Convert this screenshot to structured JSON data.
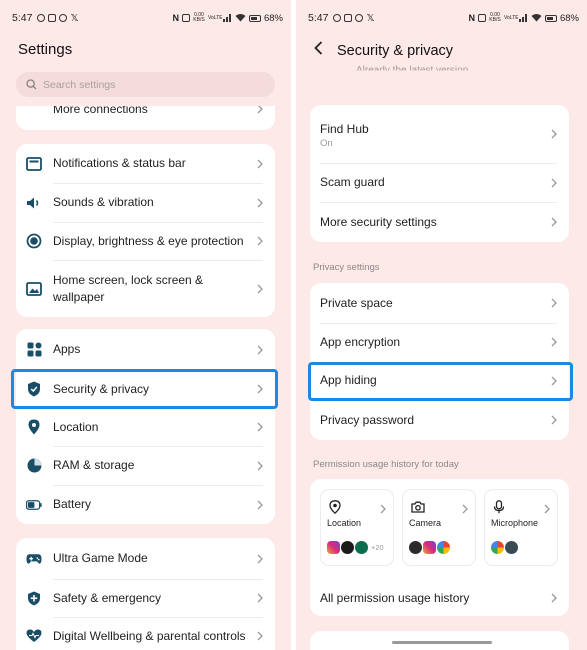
{
  "left": {
    "status": {
      "time": "5:47",
      "battery": "68%",
      "net_rate": "0.00 KB/S",
      "net_type": "VoLTE"
    },
    "title": "Settings",
    "search": {
      "placeholder": "Search settings"
    },
    "top_partial": "More connections",
    "group1": [
      {
        "label": "Notifications & status bar",
        "icon": "notification-icon"
      },
      {
        "label": "Sounds & vibration",
        "icon": "speaker-icon"
      },
      {
        "label": "Display, brightness & eye protection",
        "icon": "display-icon"
      },
      {
        "label": "Home screen, lock screen & wallpaper",
        "icon": "wallpaper-icon"
      }
    ],
    "group2": [
      {
        "label": "Apps",
        "icon": "apps-grid-icon"
      },
      {
        "label": "Security & privacy",
        "icon": "shield-icon"
      },
      {
        "label": "Location",
        "icon": "location-pin-icon"
      },
      {
        "label": "RAM & storage",
        "icon": "storage-pie-icon"
      },
      {
        "label": "Battery",
        "icon": "battery-icon"
      }
    ],
    "group3": [
      {
        "label": "Ultra Game Mode",
        "icon": "gamepad-icon"
      },
      {
        "label": "Safety & emergency",
        "icon": "safety-icon"
      },
      {
        "label": "Digital Wellbeing & parental controls",
        "icon": "wellbeing-heart-icon"
      }
    ]
  },
  "right": {
    "status": {
      "time": "5:47",
      "battery": "68%",
      "net_rate": "0.00 KB/S",
      "net_type": "VoLTE"
    },
    "title": "Security & privacy",
    "faded_top": "Already the latest version",
    "group1": [
      {
        "label": "Find Hub",
        "sub": "On"
      },
      {
        "label": "Scam guard"
      },
      {
        "label": "More security settings"
      }
    ],
    "privacy_header": "Privacy settings",
    "group2": [
      {
        "label": "Private space"
      },
      {
        "label": "App encryption"
      },
      {
        "label": "App hiding"
      },
      {
        "label": "Privacy password"
      }
    ],
    "permission_header": "Permission usage history for today",
    "permission_cards": [
      {
        "label": "Location",
        "icon": "location-pin-icon",
        "more": "+20"
      },
      {
        "label": "Camera",
        "icon": "camera-icon"
      },
      {
        "label": "Microphone",
        "icon": "microphone-icon"
      }
    ],
    "all_permission": "All permission usage history"
  },
  "colors": {
    "background": "#fde9e8",
    "card": "#ffffff",
    "highlight": "#1e88e5",
    "icon": "#1a4d66"
  }
}
